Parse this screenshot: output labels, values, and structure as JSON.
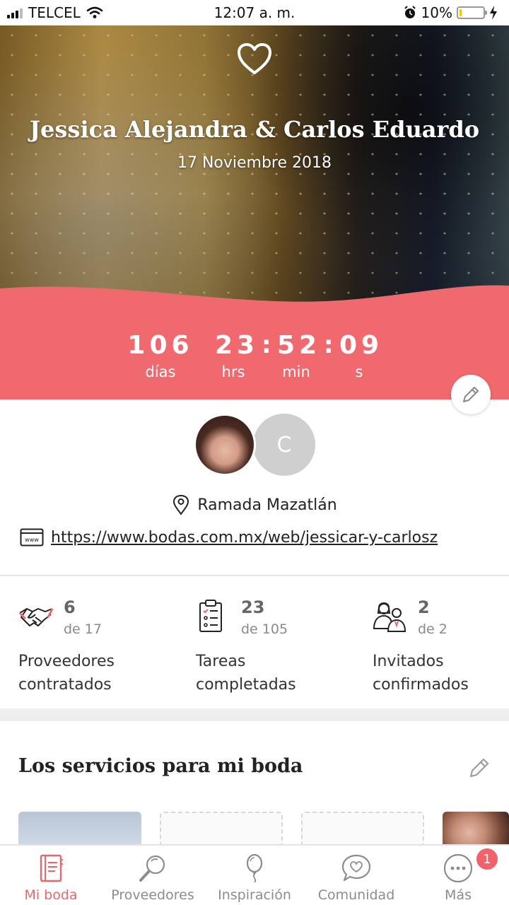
{
  "status_bar": {
    "carrier": "TELCEL",
    "time": "12:07 a. m.",
    "battery_percent": "10%",
    "battery_level": 0.1
  },
  "hero": {
    "couple_names": "Jessica Alejandra & Carlos Eduardo",
    "wedding_date": "17 Noviembre 2018"
  },
  "countdown": {
    "days": "106",
    "hours": "23",
    "minutes": "52",
    "seconds": "09",
    "separator": ":",
    "days_label": "días",
    "hours_label": "hrs",
    "minutes_label": "min",
    "seconds_label": "s"
  },
  "profile": {
    "partner_initial": "C",
    "location": "Ramada Mazatlán",
    "website": "https://www.bodas.com.mx/web/jessicar-y-carlosz"
  },
  "stats": [
    {
      "icon": "handshake-icon",
      "value": "6",
      "total": "de 17",
      "label": "Proveedores\ncontratados"
    },
    {
      "icon": "checklist-icon",
      "value": "23",
      "total": "de 105",
      "label": "Tareas\ncompletadas"
    },
    {
      "icon": "guests-icon",
      "value": "2",
      "total": "de 2",
      "label": "Invitados\nconfirmados"
    }
  ],
  "services": {
    "title": "Los servicios para mi boda"
  },
  "bottom_nav": {
    "items": [
      {
        "label": "Mi boda",
        "icon": "notebook-icon",
        "active": true
      },
      {
        "label": "Proveedores",
        "icon": "search-icon",
        "active": false
      },
      {
        "label": "Inspiración",
        "icon": "balloon-icon",
        "active": false
      },
      {
        "label": "Comunidad",
        "icon": "chat-heart-icon",
        "active": false
      },
      {
        "label": "Más",
        "icon": "more-icon",
        "active": false
      }
    ],
    "more_badge": "1"
  },
  "colors": {
    "accent": "#f0696f",
    "active_nav": "#e5686e",
    "muted": "#8c8c8c"
  }
}
